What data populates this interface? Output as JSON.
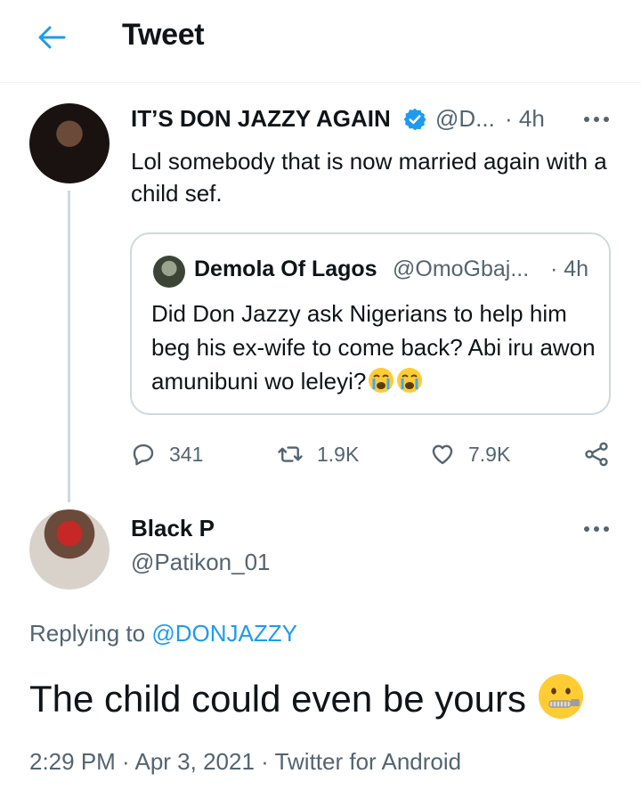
{
  "header": {
    "title": "Tweet"
  },
  "quoted_parent": {
    "name": "IT’S DON JAZZY AGAIN",
    "handle": "@D...",
    "time": "· 4h",
    "text": "Lol somebody that is now married again with a child sef.",
    "quote": {
      "name": "Demola Of Lagos",
      "handle": "@OmoGbaj...",
      "time": "· 4h",
      "text": "Did Don Jazzy ask Nigerians to help him beg his ex-wife to come back? Abi iru awon amunibuni wo leleyi?"
    },
    "stats": {
      "replies": "341",
      "retweets": "1.9K",
      "likes": "7.9K"
    }
  },
  "reply": {
    "name": "Black P",
    "handle": "@Patikon_01",
    "replying_prefix": "Replying to",
    "replying_to": "@DONJAZZY",
    "text": "The child could even be yours",
    "timestamp": "2:29 PM · Apr 3, 2021 ·",
    "source": "Twitter for Android"
  },
  "icons": [
    "back-arrow-icon",
    "verified-badge-icon",
    "more-icon",
    "reply-icon",
    "retweet-icon",
    "like-icon",
    "share-icon",
    "crying-face-emoji",
    "zipper-mouth-emoji"
  ],
  "colors": {
    "accent": "#1d9bf0",
    "secondary_text": "#536471",
    "border": "#cfd9de"
  }
}
